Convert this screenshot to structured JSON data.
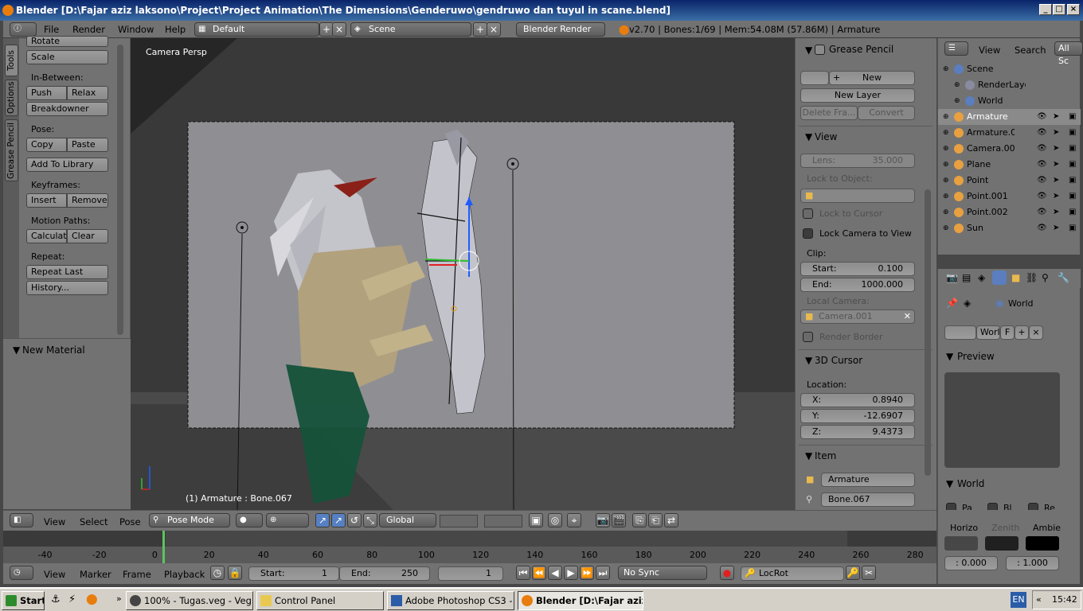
{
  "window": {
    "title": "Blender [D:\\Fajar aziz laksono\\Project\\Project Animation\\The Dimensions\\Genderuwo\\gendruwo dan tuyul in scane.blend]"
  },
  "menubar": {
    "menus": [
      "File",
      "Render",
      "Window",
      "Help"
    ],
    "layout": "Default",
    "scene": "Scene",
    "engine": "Blender Render",
    "status": "v2.70 | Bones:1/69 | Mem:54.08M (57.86M) | Armature"
  },
  "toolshelf": {
    "tabs": [
      "Tools",
      "Options",
      "Grease Pencil"
    ],
    "rotate": "Rotate",
    "scale": "Scale",
    "inbetween_label": "In-Between:",
    "push": "Push",
    "relax": "Relax",
    "breakdowner": "Breakdowner",
    "pose_label": "Pose:",
    "copy": "Copy",
    "paste": "Paste",
    "add_library": "Add To Library",
    "keyframes_label": "Keyframes:",
    "insert": "Insert",
    "remove": "Remove",
    "motion_label": "Motion Paths:",
    "calculate": "Calculat",
    "clear": "Clear",
    "repeat_label": "Repeat:",
    "repeat_last": "Repeat Last",
    "history": "History...",
    "new_material": "New Material"
  },
  "viewport": {
    "camera_label": "Camera Persp",
    "object_label": "(1) Armature : Bone.067"
  },
  "npanel": {
    "grease_pencil": "Grease Pencil",
    "new": "New",
    "new_layer": "New Layer",
    "delete_frame": "Delete Fra...",
    "convert": "Convert",
    "view": "View",
    "lens_label": "Lens:",
    "lens_value": "35.000",
    "lock_object": "Lock to Object:",
    "lock_cursor": "Lock to Cursor",
    "lock_camera": "Lock Camera to View",
    "clip": "Clip:",
    "start_label": "Start:",
    "start_value": "0.100",
    "end_label": "End:",
    "end_value": "1000.000",
    "local_camera": "Local Camera:",
    "camera_value": "Camera.001",
    "render_border": "Render Border",
    "cursor": "3D Cursor",
    "location": "Location:",
    "x_label": "X:",
    "x_value": "0.8940",
    "y_label": "Y:",
    "y_value": "-12.6907",
    "z_label": "Z:",
    "z_value": "9.4373",
    "item": "Item",
    "item_object": "Armature",
    "item_bone": "Bone.067"
  },
  "outliner": {
    "menus": [
      "View",
      "Search"
    ],
    "filter": "All Sc",
    "rows": [
      "Scene",
      "RenderLaye",
      "World",
      "Armature",
      "Armature.0",
      "Camera.00",
      "Plane",
      "Point",
      "Point.001",
      "Point.002",
      "Sun"
    ]
  },
  "properties": {
    "context": "World",
    "world_name": "Worl",
    "fake": "F",
    "preview": "Preview",
    "world_panel": "World",
    "pa": "Pa",
    "bl": "Bl",
    "re": "Re",
    "horizon": "Horizo",
    "zenith": "Zenith",
    "ambient": "Ambie",
    "val1": ": 0.000",
    "val2": ": 1.000"
  },
  "viewport_header": {
    "menus": [
      "View",
      "Select",
      "Pose"
    ],
    "mode": "Pose Mode",
    "orientation": "Global"
  },
  "timeline": {
    "ticks": [
      "-40",
      "-20",
      "0",
      "20",
      "40",
      "60",
      "80",
      "100",
      "120",
      "140",
      "160",
      "180",
      "200",
      "220",
      "240",
      "260",
      "280"
    ],
    "current_frame_value": 1
  },
  "timeline_header": {
    "menus": [
      "View",
      "Marker",
      "Frame",
      "Playback"
    ],
    "start_label": "Start:",
    "start_value": "1",
    "end_label": "End:",
    "end_value": "250",
    "current": "1",
    "sync": "No Sync",
    "keyingset": "LocRot"
  },
  "taskbar": {
    "start": "Start",
    "tasks": [
      "100% - Tugas.veg - Veg...",
      "Control Panel",
      "Adobe Photoshop CS3 - ...",
      "Blender [D:\\Fajar aziz..."
    ],
    "lang": "EN",
    "time": "15:42"
  }
}
